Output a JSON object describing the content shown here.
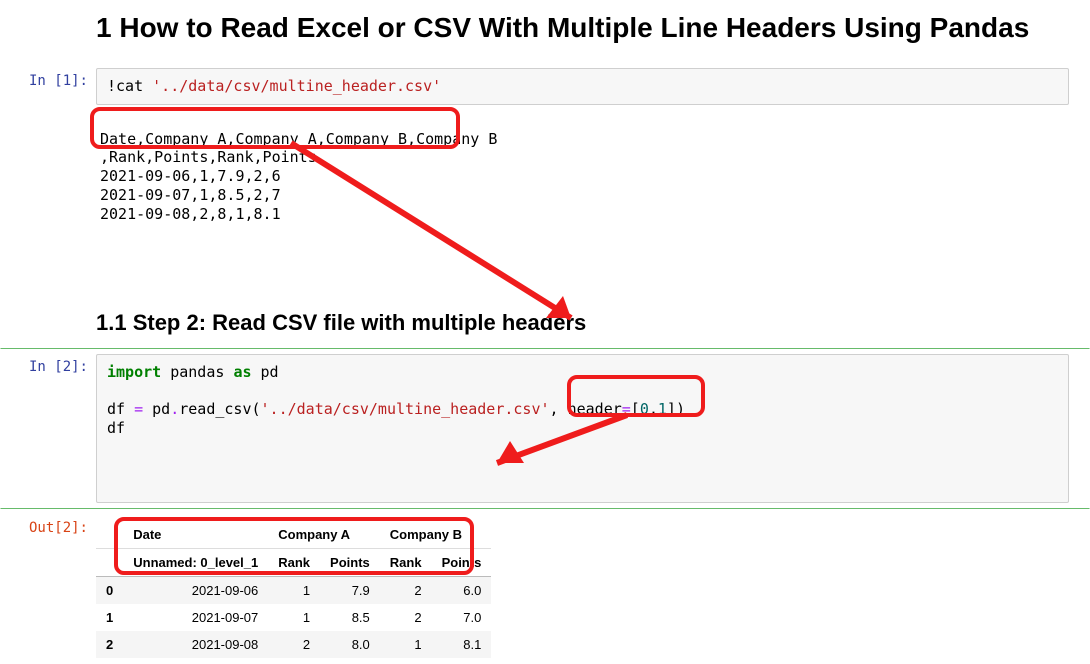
{
  "title_h1": "1  How to Read Excel or CSV With Multiple Line Headers Using Pandas",
  "title_h2": "1.1  Step 2: Read CSV file with multiple headers",
  "prompts": {
    "in1": "In [1]:",
    "in2": "In [2]:",
    "out2": "Out[2]:"
  },
  "code1": {
    "bang": "!",
    "cmd": "cat ",
    "path": "'../data/csv/multine_header.csv'"
  },
  "out1_lines": [
    "Date,Company A,Company A,Company B,Company B",
    ",Rank,Points,Rank,Points",
    "2021-09-06,1,7.9,2,6",
    "2021-09-07,1,8.5,2,7",
    "2021-09-08,2,8,1,8.1"
  ],
  "code2": {
    "import": "import",
    "pandas": " pandas ",
    "as": "as",
    "pd": " pd",
    "line2a": "df ",
    "eq": "=",
    "line2b": " pd",
    "dot": ".",
    "read": "read_csv(",
    "path": "'../data/csv/multine_header.csv'",
    "comma": ", ",
    "header": "header",
    "eq2": "=",
    "br1": "[",
    "z0": "0",
    "c": ",",
    "z1": "1",
    "br2": "])",
    "line3": "df"
  },
  "df": {
    "top_headers": [
      "",
      "Date",
      "Company A",
      "Company A",
      "Company B",
      "Company B"
    ],
    "sub_headers": [
      "",
      "Unnamed: 0_level_1",
      "Rank",
      "Points",
      "Rank",
      "Points"
    ],
    "rows": [
      [
        "0",
        "2021-09-06",
        "1",
        "7.9",
        "2",
        "6.0"
      ],
      [
        "1",
        "2021-09-07",
        "1",
        "8.5",
        "2",
        "7.0"
      ],
      [
        "2",
        "2021-09-08",
        "2",
        "8.0",
        "1",
        "8.1"
      ]
    ]
  },
  "chart_data": {
    "type": "table",
    "columns_level_0": [
      "Date",
      "Company A",
      "Company A",
      "Company B",
      "Company B"
    ],
    "columns_level_1": [
      "Unnamed: 0_level_1",
      "Rank",
      "Points",
      "Rank",
      "Points"
    ],
    "index": [
      0,
      1,
      2
    ],
    "data": [
      [
        "2021-09-06",
        1,
        7.9,
        2,
        6.0
      ],
      [
        "2021-09-07",
        1,
        8.5,
        2,
        7.0
      ],
      [
        "2021-09-08",
        2,
        8.0,
        1,
        8.1
      ]
    ]
  }
}
